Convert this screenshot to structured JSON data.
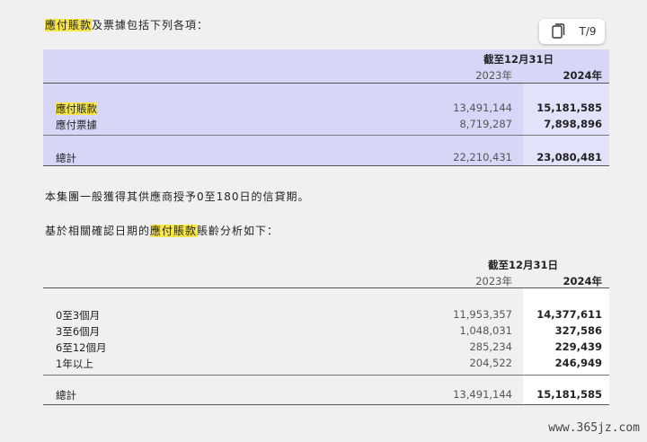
{
  "intro": {
    "highlight": "應付賬款",
    "rest": "及票據包括下列各項："
  },
  "toolbar": {
    "translate_label": "T/9"
  },
  "table1": {
    "header_date": "截至12月31日",
    "col_2023": "2023年",
    "col_2024": "2024年",
    "rows": [
      {
        "label": "應付賬款",
        "v2023": "13,491,144",
        "v2024": "15,181,585"
      },
      {
        "label": "應付票據",
        "v2023": "8,719,287",
        "v2024": "7,898,896"
      }
    ],
    "total": {
      "label": "總計",
      "v2023": "22,210,431",
      "v2024": "23,080,481"
    }
  },
  "para1": "本集團一般獲得其供應商授予0至180日的信貸期。",
  "para2": {
    "before": "基於相關確認日期的",
    "highlight": "應付賬款",
    "after": "賬齡分析如下："
  },
  "table2": {
    "header_date": "截至12月31日",
    "col_2023": "2023年",
    "col_2024": "2024年",
    "rows": [
      {
        "label": "0至3個月",
        "v2023": "11,953,357",
        "v2024": "14,377,611"
      },
      {
        "label": "3至6個月",
        "v2023": "1,048,031",
        "v2024": "327,586"
      },
      {
        "label": "6至12個月",
        "v2023": "285,234",
        "v2024": "229,439"
      },
      {
        "label": "1年以上",
        "v2023": "204,522",
        "v2024": "246,949"
      }
    ],
    "total": {
      "label": "總計",
      "v2023": "13,491,144",
      "v2024": "15,181,585"
    }
  },
  "watermark": "www.365jz.com"
}
